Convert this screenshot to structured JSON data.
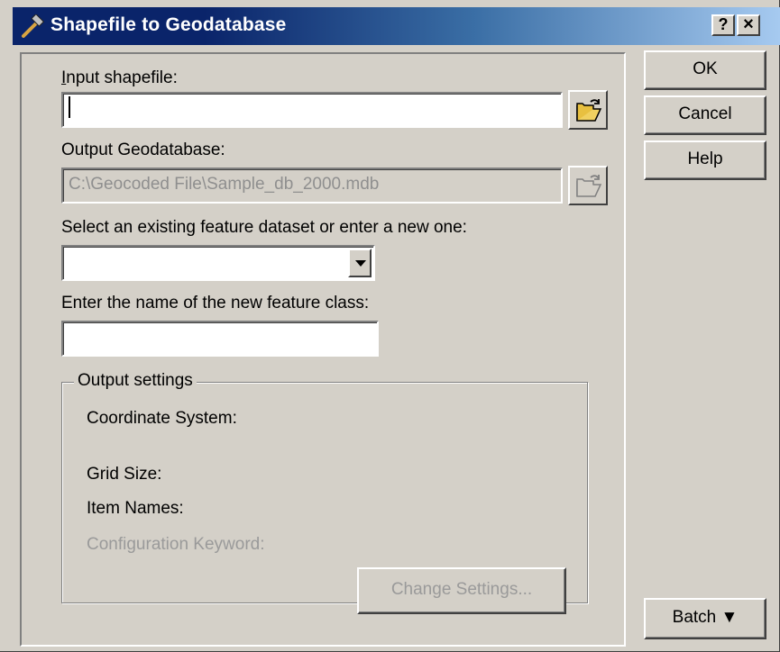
{
  "window": {
    "title": "Shapefile to Geodatabase",
    "help_caption": "?",
    "close_caption": "×"
  },
  "form": {
    "input_shapefile_label": "Input shapefile:",
    "input_shapefile_value": "",
    "output_gdb_label": "Output Geodatabase:",
    "output_gdb_value": "C:\\Geocoded File\\Sample_db_2000.mdb",
    "dataset_label": "Select an existing feature dataset or enter a new one:",
    "dataset_value": "",
    "feature_class_label": "Enter the name of the new feature class:",
    "feature_class_value": ""
  },
  "output_settings": {
    "legend": "Output settings",
    "coordinate_system": "Coordinate System:",
    "grid_size": "Grid Size:",
    "item_names": "Item Names:",
    "config_keyword": "Configuration Keyword:",
    "change_settings": "Change Settings..."
  },
  "buttons": {
    "ok": "OK",
    "cancel": "Cancel",
    "help": "Help",
    "batch": "Batch ▼"
  },
  "icons": {
    "app": "hammer-icon",
    "browse": "open-folder-icon"
  }
}
